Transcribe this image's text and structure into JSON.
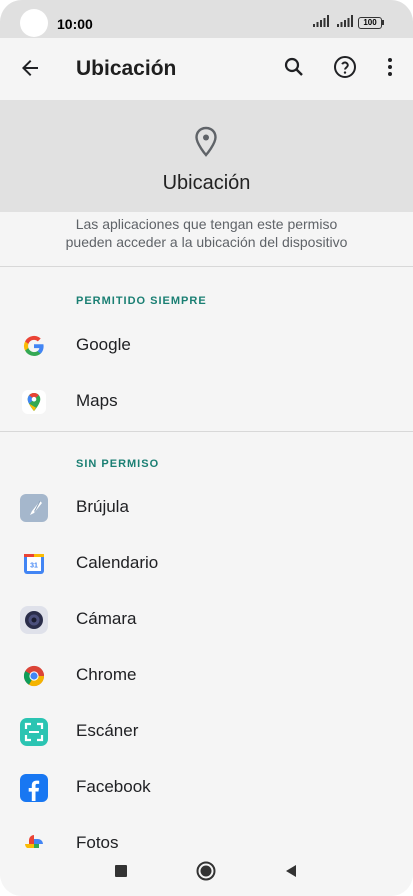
{
  "status_bar": {
    "time": "10:00",
    "battery": "100"
  },
  "app_bar": {
    "title": "Ubicación",
    "back_icon": "arrow-left-icon",
    "search_icon": "search-icon",
    "help_icon": "help-circle-icon",
    "more_icon": "more-vert-icon"
  },
  "header": {
    "icon": "location-pin-icon",
    "title": "Ubicación",
    "description_line1": "Las aplicaciones que tengan este permiso",
    "description_line2": "pueden acceder a la ubicación del dispositivo"
  },
  "sections": {
    "allowed_label": "PERMITIDO SIEMPRE",
    "allowed_apps": [
      {
        "name": "Google",
        "icon": "google-icon"
      },
      {
        "name": "Maps",
        "icon": "maps-icon"
      }
    ],
    "denied_label": "SIN PERMISO",
    "denied_apps": [
      {
        "name": "Brújula",
        "icon": "compass-icon"
      },
      {
        "name": "Calendario",
        "icon": "calendar-icon"
      },
      {
        "name": "Cámara",
        "icon": "camera-icon"
      },
      {
        "name": "Chrome",
        "icon": "chrome-icon"
      },
      {
        "name": "Escáner",
        "icon": "scanner-icon"
      },
      {
        "name": "Facebook",
        "icon": "facebook-icon"
      },
      {
        "name": "Fotos",
        "icon": "photos-icon"
      }
    ]
  },
  "colors": {
    "accent": "#1a7f73",
    "header_bg": "#e1e1e1",
    "background": "#f5f5f5"
  }
}
